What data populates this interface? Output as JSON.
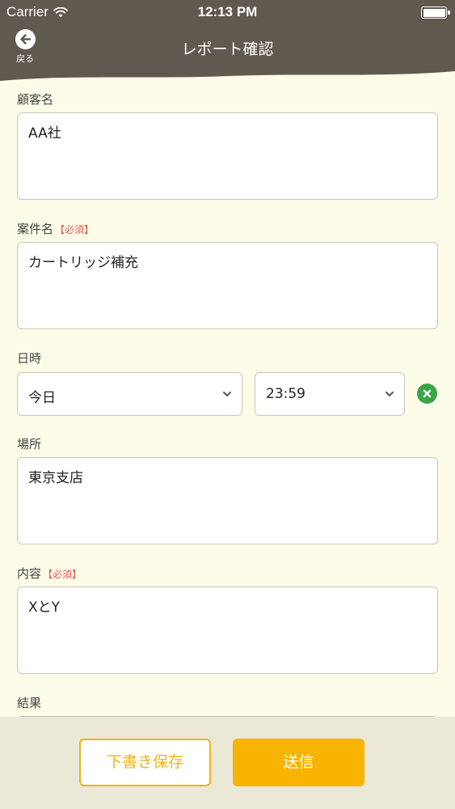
{
  "status_bar": {
    "carrier": "Carrier",
    "time": "12:13 PM"
  },
  "nav": {
    "back_label": "戻る",
    "title": "レポート確認"
  },
  "form": {
    "customer": {
      "label": "顧客名",
      "value": "AA社"
    },
    "project": {
      "label": "案件名",
      "required": "【必須】",
      "value": "カートリッジ補充"
    },
    "datetime": {
      "label": "日時",
      "date_value": "今日",
      "time_value": "23:59"
    },
    "location": {
      "label": "場所",
      "value": "東京支店"
    },
    "content": {
      "label": "内容",
      "required": "【必須】",
      "value": "XとY"
    },
    "result": {
      "label": "結果"
    }
  },
  "footer": {
    "draft_label": "下書き保存",
    "send_label": "送信"
  },
  "colors": {
    "header": "#605950",
    "background": "#fdfce8",
    "accent": "#f8b400",
    "required": "#e25a4f",
    "clear": "#3aa548"
  }
}
